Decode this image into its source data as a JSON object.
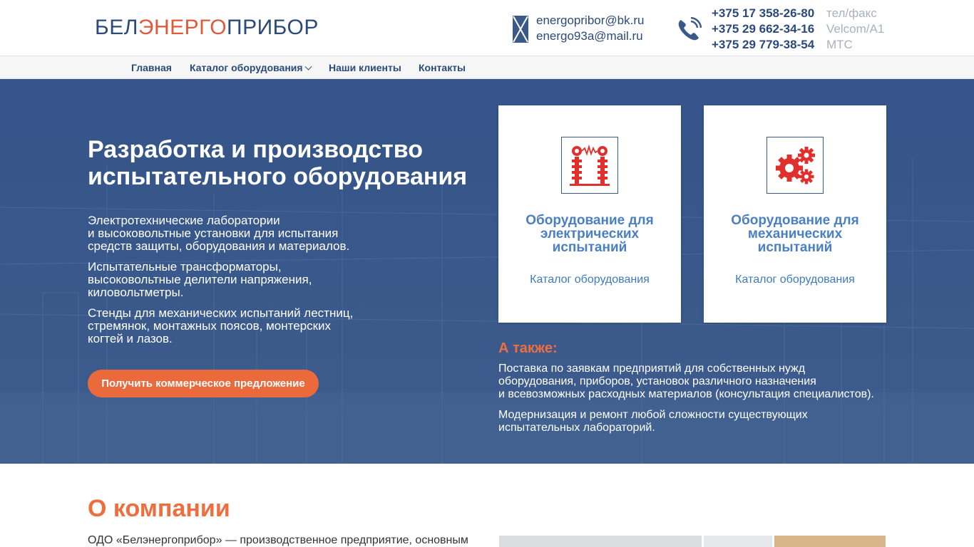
{
  "logo": {
    "part1": "БЕЛ",
    "part2": "ЭНЕРГО",
    "part3": "ПРИБОР"
  },
  "contacts": {
    "emails": [
      "energopribor@bk.ru",
      "energo93a@mail.ru"
    ],
    "phones": [
      {
        "number": "+375 17 358-26-80",
        "type": "тел/факс"
      },
      {
        "number": "+375 29 662-34-16",
        "type": "Velcom/A1"
      },
      {
        "number": "+375 29 779-38-54",
        "type": "МТС"
      }
    ]
  },
  "nav": {
    "home": "Главная",
    "catalog": "Каталог оборудования",
    "clients": "Наши клиенты",
    "contacts": "Контакты"
  },
  "hero": {
    "title_line1": "Разработка и производство",
    "title_line2": "испытательного оборудования",
    "p1_l1": "Электротехнические лаборатории",
    "p1_l2": "и высоковольтные установки для испытания",
    "p1_l3": "средств защиты, оборудования и материалов.",
    "p2_l1": "Испытательные трансформаторы,",
    "p2_l2": "высоковольтные делители напряжения,",
    "p2_l3": "киловольтметры.",
    "p3_l1": "Стенды для механических испытаний лестниц,",
    "p3_l2": "стремянок, монтажных поясов, монтерских",
    "p3_l3": "когтей и лазов.",
    "cta": "Получить коммерческое предложение"
  },
  "cards": [
    {
      "title_l1": "Оборудование для",
      "title_l2": "электрических",
      "title_l3": "испытаний",
      "link": "Каталог оборудования",
      "icon": "transformer-icon"
    },
    {
      "title_l1": "Оборудование для",
      "title_l2": "механических",
      "title_l3": "испытаний",
      "link": "Каталог оборудования",
      "icon": "gears-icon"
    }
  ],
  "also": {
    "title": "А также:",
    "p1_l1": "Поставка по заявкам предприятий для собственных нужд",
    "p1_l2": "оборудования, приборов, установок различного назначения",
    "p1_l3": "и всевозможных расходных материалов (консультация специалистов).",
    "p2_l1": "Модернизация и ремонт любой сложности существующих",
    "p2_l2": "испытательных лабораторий."
  },
  "about": {
    "title": "О компании",
    "text": "ОДО «Белэнергоприбор» — производственное предприятие, основным"
  },
  "colors": {
    "brand_blue": "#2b4a7a",
    "accent_orange": "#ea6a3c",
    "hero_bg": "#3a5988",
    "icon_red": "#e0302e"
  }
}
